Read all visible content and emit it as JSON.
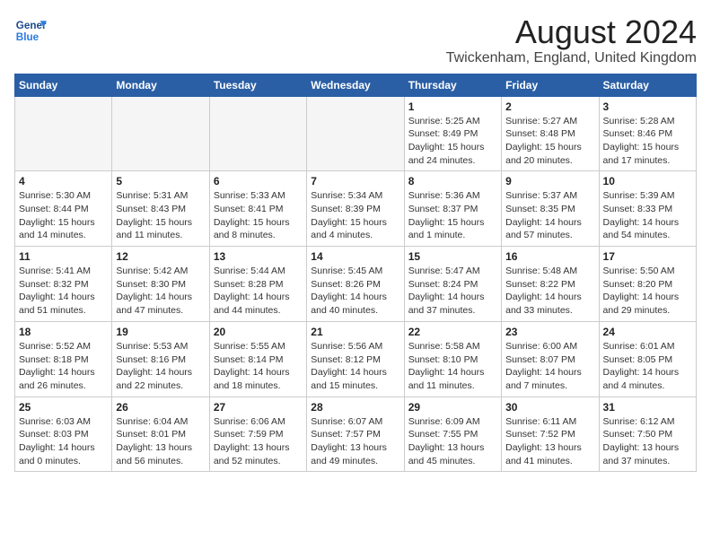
{
  "header": {
    "logo_line1": "General",
    "logo_line2": "Blue",
    "main_title": "August 2024",
    "subtitle": "Twickenham, England, United Kingdom"
  },
  "weekdays": [
    "Sunday",
    "Monday",
    "Tuesday",
    "Wednesday",
    "Thursday",
    "Friday",
    "Saturday"
  ],
  "weeks": [
    [
      {
        "day": "",
        "info": ""
      },
      {
        "day": "",
        "info": ""
      },
      {
        "day": "",
        "info": ""
      },
      {
        "day": "",
        "info": ""
      },
      {
        "day": "1",
        "info": "Sunrise: 5:25 AM\nSunset: 8:49 PM\nDaylight: 15 hours\nand 24 minutes."
      },
      {
        "day": "2",
        "info": "Sunrise: 5:27 AM\nSunset: 8:48 PM\nDaylight: 15 hours\nand 20 minutes."
      },
      {
        "day": "3",
        "info": "Sunrise: 5:28 AM\nSunset: 8:46 PM\nDaylight: 15 hours\nand 17 minutes."
      }
    ],
    [
      {
        "day": "4",
        "info": "Sunrise: 5:30 AM\nSunset: 8:44 PM\nDaylight: 15 hours\nand 14 minutes."
      },
      {
        "day": "5",
        "info": "Sunrise: 5:31 AM\nSunset: 8:43 PM\nDaylight: 15 hours\nand 11 minutes."
      },
      {
        "day": "6",
        "info": "Sunrise: 5:33 AM\nSunset: 8:41 PM\nDaylight: 15 hours\nand 8 minutes."
      },
      {
        "day": "7",
        "info": "Sunrise: 5:34 AM\nSunset: 8:39 PM\nDaylight: 15 hours\nand 4 minutes."
      },
      {
        "day": "8",
        "info": "Sunrise: 5:36 AM\nSunset: 8:37 PM\nDaylight: 15 hours\nand 1 minute."
      },
      {
        "day": "9",
        "info": "Sunrise: 5:37 AM\nSunset: 8:35 PM\nDaylight: 14 hours\nand 57 minutes."
      },
      {
        "day": "10",
        "info": "Sunrise: 5:39 AM\nSunset: 8:33 PM\nDaylight: 14 hours\nand 54 minutes."
      }
    ],
    [
      {
        "day": "11",
        "info": "Sunrise: 5:41 AM\nSunset: 8:32 PM\nDaylight: 14 hours\nand 51 minutes."
      },
      {
        "day": "12",
        "info": "Sunrise: 5:42 AM\nSunset: 8:30 PM\nDaylight: 14 hours\nand 47 minutes."
      },
      {
        "day": "13",
        "info": "Sunrise: 5:44 AM\nSunset: 8:28 PM\nDaylight: 14 hours\nand 44 minutes."
      },
      {
        "day": "14",
        "info": "Sunrise: 5:45 AM\nSunset: 8:26 PM\nDaylight: 14 hours\nand 40 minutes."
      },
      {
        "day": "15",
        "info": "Sunrise: 5:47 AM\nSunset: 8:24 PM\nDaylight: 14 hours\nand 37 minutes."
      },
      {
        "day": "16",
        "info": "Sunrise: 5:48 AM\nSunset: 8:22 PM\nDaylight: 14 hours\nand 33 minutes."
      },
      {
        "day": "17",
        "info": "Sunrise: 5:50 AM\nSunset: 8:20 PM\nDaylight: 14 hours\nand 29 minutes."
      }
    ],
    [
      {
        "day": "18",
        "info": "Sunrise: 5:52 AM\nSunset: 8:18 PM\nDaylight: 14 hours\nand 26 minutes."
      },
      {
        "day": "19",
        "info": "Sunrise: 5:53 AM\nSunset: 8:16 PM\nDaylight: 14 hours\nand 22 minutes."
      },
      {
        "day": "20",
        "info": "Sunrise: 5:55 AM\nSunset: 8:14 PM\nDaylight: 14 hours\nand 18 minutes."
      },
      {
        "day": "21",
        "info": "Sunrise: 5:56 AM\nSunset: 8:12 PM\nDaylight: 14 hours\nand 15 minutes."
      },
      {
        "day": "22",
        "info": "Sunrise: 5:58 AM\nSunset: 8:10 PM\nDaylight: 14 hours\nand 11 minutes."
      },
      {
        "day": "23",
        "info": "Sunrise: 6:00 AM\nSunset: 8:07 PM\nDaylight: 14 hours\nand 7 minutes."
      },
      {
        "day": "24",
        "info": "Sunrise: 6:01 AM\nSunset: 8:05 PM\nDaylight: 14 hours\nand 4 minutes."
      }
    ],
    [
      {
        "day": "25",
        "info": "Sunrise: 6:03 AM\nSunset: 8:03 PM\nDaylight: 14 hours\nand 0 minutes."
      },
      {
        "day": "26",
        "info": "Sunrise: 6:04 AM\nSunset: 8:01 PM\nDaylight: 13 hours\nand 56 minutes."
      },
      {
        "day": "27",
        "info": "Sunrise: 6:06 AM\nSunset: 7:59 PM\nDaylight: 13 hours\nand 52 minutes."
      },
      {
        "day": "28",
        "info": "Sunrise: 6:07 AM\nSunset: 7:57 PM\nDaylight: 13 hours\nand 49 minutes."
      },
      {
        "day": "29",
        "info": "Sunrise: 6:09 AM\nSunset: 7:55 PM\nDaylight: 13 hours\nand 45 minutes."
      },
      {
        "day": "30",
        "info": "Sunrise: 6:11 AM\nSunset: 7:52 PM\nDaylight: 13 hours\nand 41 minutes."
      },
      {
        "day": "31",
        "info": "Sunrise: 6:12 AM\nSunset: 7:50 PM\nDaylight: 13 hours\nand 37 minutes."
      }
    ]
  ]
}
